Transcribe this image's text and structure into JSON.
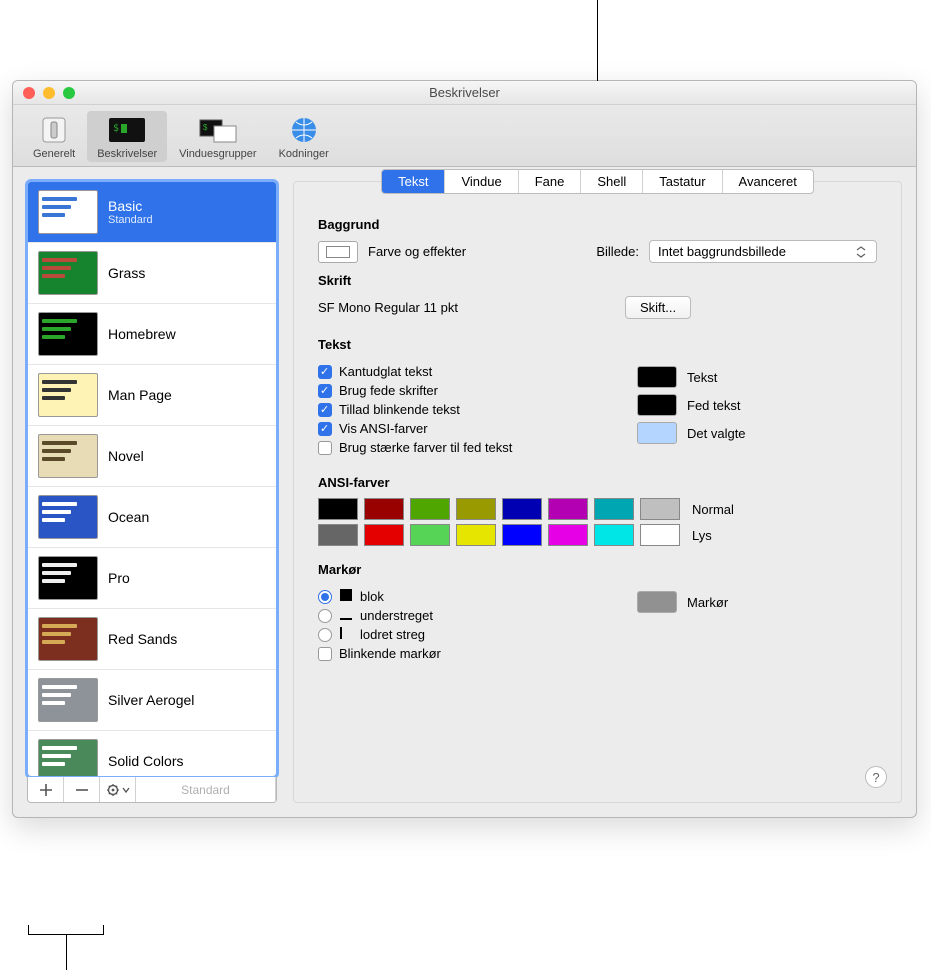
{
  "window": {
    "title": "Beskrivelser"
  },
  "toolbar": {
    "items": [
      {
        "label": "Generelt"
      },
      {
        "label": "Beskrivelser"
      },
      {
        "label": "Vinduesgrupper"
      },
      {
        "label": "Kodninger"
      }
    ]
  },
  "profiles": {
    "list": [
      {
        "name": "Basic",
        "sub": "Standard",
        "bg": "#ffffff",
        "fg": "#3a76d6"
      },
      {
        "name": "Grass",
        "bg": "#16832e",
        "fg": "#b84b3a"
      },
      {
        "name": "Homebrew",
        "bg": "#000000",
        "fg": "#2aa62a"
      },
      {
        "name": "Man Page",
        "bg": "#fef3b5",
        "fg": "#333333"
      },
      {
        "name": "Novel",
        "bg": "#e7dcb5",
        "fg": "#5a4a2a"
      },
      {
        "name": "Ocean",
        "bg": "#2a55c5",
        "fg": "#ffffff"
      },
      {
        "name": "Pro",
        "bg": "#000000",
        "fg": "#eeeeee"
      },
      {
        "name": "Red Sands",
        "bg": "#7c2e1f",
        "fg": "#d6a957"
      },
      {
        "name": "Silver Aerogel",
        "bg": "#8d9399",
        "fg": "#ffffff"
      },
      {
        "name": "Solid Colors",
        "bg": "#4a8a5a",
        "fg": "#ffffff"
      }
    ],
    "default_label": "Standard"
  },
  "tabs": [
    "Tekst",
    "Vindue",
    "Fane",
    "Shell",
    "Tastatur",
    "Avanceret"
  ],
  "sections": {
    "background": {
      "heading": "Baggrund",
      "color_effects_label": "Farve og effekter",
      "image_label": "Billede:",
      "image_value": "Intet baggrundsbillede",
      "well_color": "#ffffff"
    },
    "font": {
      "heading": "Skrift",
      "value": "SF Mono Regular 11 pkt",
      "change_button": "Skift..."
    },
    "text": {
      "heading": "Tekst",
      "options": [
        "Kantudglat tekst",
        "Brug fede skrifter",
        "Tillad blinkende tekst",
        "Vis ANSI-farver",
        "Brug stærke farver til fed tekst"
      ],
      "colors": [
        {
          "label": "Tekst",
          "value": "#000000"
        },
        {
          "label": "Fed tekst",
          "value": "#000000"
        },
        {
          "label": "Det valgte",
          "value": "#b4d5ff"
        }
      ]
    },
    "ansi": {
      "heading": "ANSI-farver",
      "normal_label": "Normal",
      "bright_label": "Lys",
      "normal": [
        "#000000",
        "#990000",
        "#4fa600",
        "#999900",
        "#0000b2",
        "#b200b2",
        "#00a6b2",
        "#bfbfbf"
      ],
      "bright": [
        "#666666",
        "#e50000",
        "#55d455",
        "#e5e500",
        "#0000ff",
        "#e500e5",
        "#00e5e5",
        "#ffffff"
      ]
    },
    "cursor": {
      "heading": "Markør",
      "options": [
        "blok",
        "understreget",
        "lodret streg"
      ],
      "blink_label": "Blinkende markør",
      "color_label": "Markør",
      "color": "#919191"
    }
  }
}
